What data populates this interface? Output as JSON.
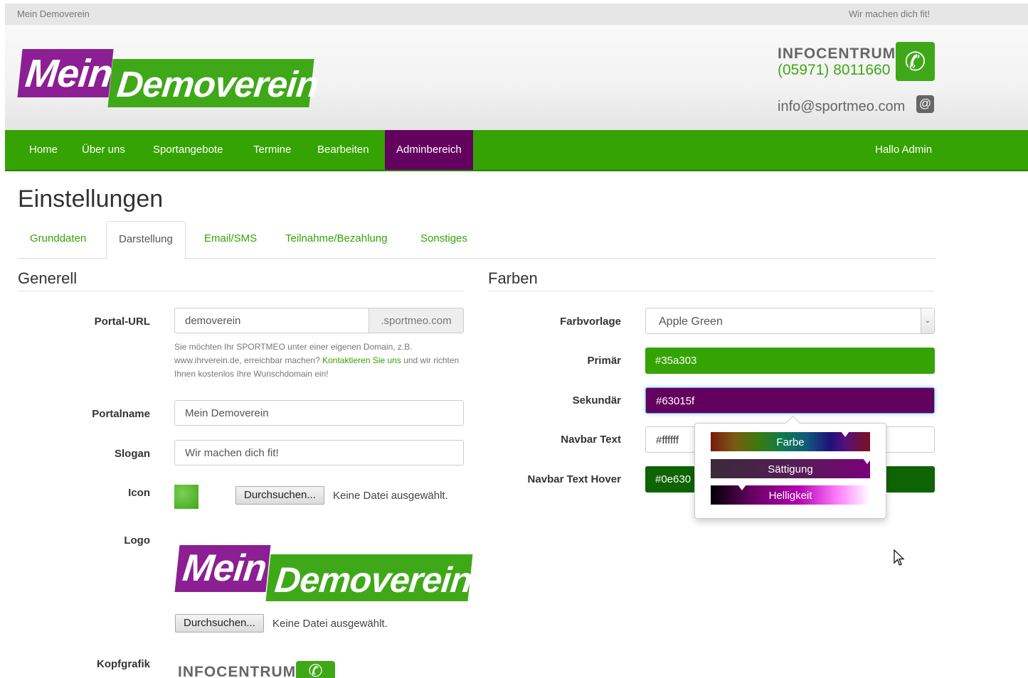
{
  "topbar": {
    "left": "Mein Demoverein",
    "right": "Wir machen dich fit!"
  },
  "header": {
    "logo_part1": "Mein",
    "logo_part2": "Demoverein",
    "info_title": "INFOCENTRUM",
    "info_phone": "(05971) 8011660",
    "info_email": "info@sportmeo.com",
    "phone_icon": "phone-icon",
    "email_icon": "at-icon"
  },
  "navbar": {
    "items": [
      "Home",
      "Über uns",
      "Sportangebote",
      "Termine",
      "Bearbeiten",
      "Adminbereich"
    ],
    "active": "Adminbereich",
    "greeting": "Hallo Admin"
  },
  "page": {
    "title": "Einstellungen",
    "tabs": [
      "Grunddaten",
      "Darstellung",
      "Email/SMS",
      "Teilnahme/Bezahlung",
      "Sonstiges"
    ],
    "active_tab": "Darstellung"
  },
  "generell": {
    "title": "Generell",
    "portal_url_label": "Portal-URL",
    "portal_url_value": "demoverein",
    "portal_url_suffix": ".sportmeo.com",
    "help_text_1": "Sie möchten Ihr SPORTMEO unter einer eigenen Domain, z.B. www.ihrverein.de, erreichbar machen? ",
    "help_link": "Kontaktieren Sie uns",
    "help_text_2": " und wir richten Ihnen kostenlos Ihre Wunschdomain ein!",
    "portalname_label": "Portalname",
    "portalname_value": "Mein Demoverein",
    "slogan_label": "Slogan",
    "slogan_value": "Wir machen dich fit!",
    "icon_label": "Icon",
    "browse_label": "Durchsuchen...",
    "no_file": "Keine Datei ausgewählt.",
    "logo_label": "Logo",
    "kopfgrafik_label": "Kopfgrafik",
    "kopfgrafik_preview_text": "INFOCENTRUM"
  },
  "farben": {
    "title": "Farben",
    "farbvorlage_label": "Farbvorlage",
    "farbvorlage_value": "Apple Green",
    "primaer_label": "Primär",
    "primaer_value": "#35a303",
    "sekundaer_label": "Sekundär",
    "sekundaer_value": "#63015f",
    "navbar_text_label": "Navbar Text",
    "navbar_text_value": "#ffffff",
    "navbar_hover_label": "Navbar Text Hover",
    "navbar_hover_value": "#0e630",
    "picker": {
      "farbe": "Farbe",
      "saettigung": "Sättigung",
      "helligkeit": "Helligkeit"
    }
  },
  "colors": {
    "primary": "#35a303",
    "secondary": "#63015f",
    "hover": "#0e6303",
    "brand_purple": "#8b1f93",
    "brand_green": "#3fa818"
  }
}
